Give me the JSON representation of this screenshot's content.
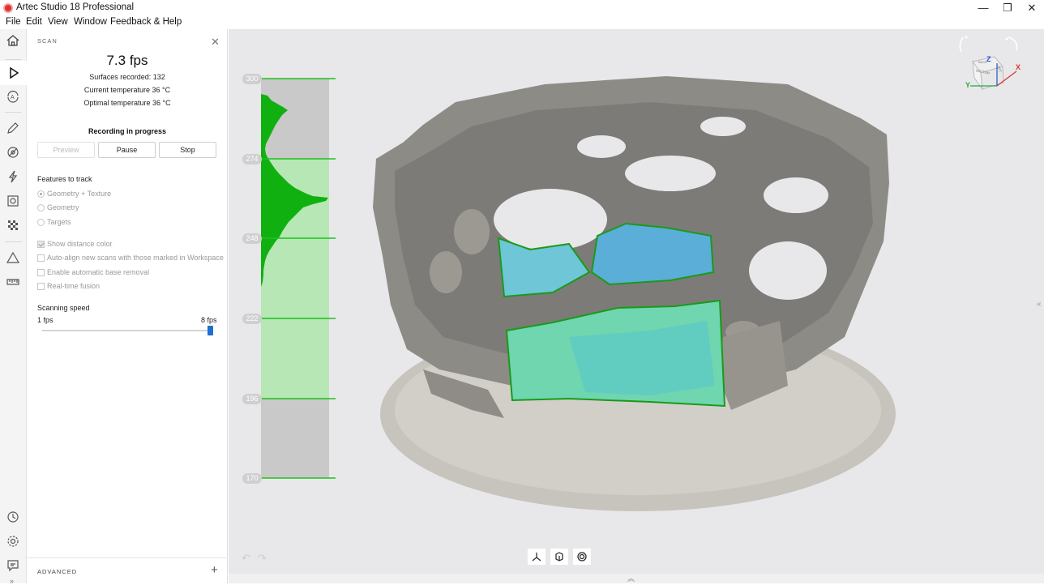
{
  "window": {
    "title": "Artec Studio 18 Professional",
    "minimize": "—",
    "restore": "❐",
    "close": "✕"
  },
  "menu": [
    "File",
    "Edit",
    "View",
    "Window",
    "Feedback & Help"
  ],
  "toolbar": {
    "tools": [
      "home-icon",
      "scan-play-icon",
      "autopilot-icon",
      "edit-pencil-icon",
      "tools-icon",
      "fusion-bolt-icon",
      "texture-icon",
      "checker-icon",
      "measure-triangle-icon",
      "ruler-icon"
    ],
    "bottom_tools": [
      "history-icon",
      "settings-gear-icon",
      "chat-feedback-icon"
    ]
  },
  "scan_panel": {
    "title": "SCAN",
    "fps": "7.3 fps",
    "surfaces_recorded": "Surfaces recorded: 132",
    "current_temperature": "Current temperature 36 °C",
    "optimal_temperature": "Optimal temperature 36 °C",
    "recording_status": "Recording in progress",
    "buttons": {
      "preview": "Preview",
      "pause": "Pause",
      "stop": "Stop"
    },
    "features_heading": "Features to track",
    "features": [
      {
        "label": "Geometry + Texture",
        "selected": true
      },
      {
        "label": "Geometry",
        "selected": false
      },
      {
        "label": "Targets",
        "selected": false
      }
    ],
    "options": [
      {
        "label": "Show distance color",
        "checked": true
      },
      {
        "label": "Auto-align new scans with those marked in Workspace",
        "checked": false
      },
      {
        "label": "Enable automatic base removal",
        "checked": false
      },
      {
        "label": "Real-time fusion",
        "checked": false
      }
    ],
    "speed_heading": "Scanning speed",
    "speed_min": "1 fps",
    "speed_max": "8 fps",
    "speed_value_fraction": 1.0,
    "advanced_label": "ADVANCED"
  },
  "viewport": {
    "distance_ticks": [
      "300",
      "274",
      "248",
      "222",
      "196",
      "170"
    ],
    "axis_labels": {
      "x": "X",
      "y": "Y",
      "z": "Z"
    },
    "view_cube_labels": {
      "back": "BACK",
      "bottom": "BOTTOM",
      "left": "LEFT"
    },
    "bottom_buttons": [
      "transform-icon",
      "object-mode-icon",
      "target-icon"
    ],
    "colors": {
      "range_band": "#b6e7b4",
      "histogram": "#11b011",
      "tick_line": "#1fbf1f",
      "scan_outline": "#1a9a1a"
    }
  }
}
